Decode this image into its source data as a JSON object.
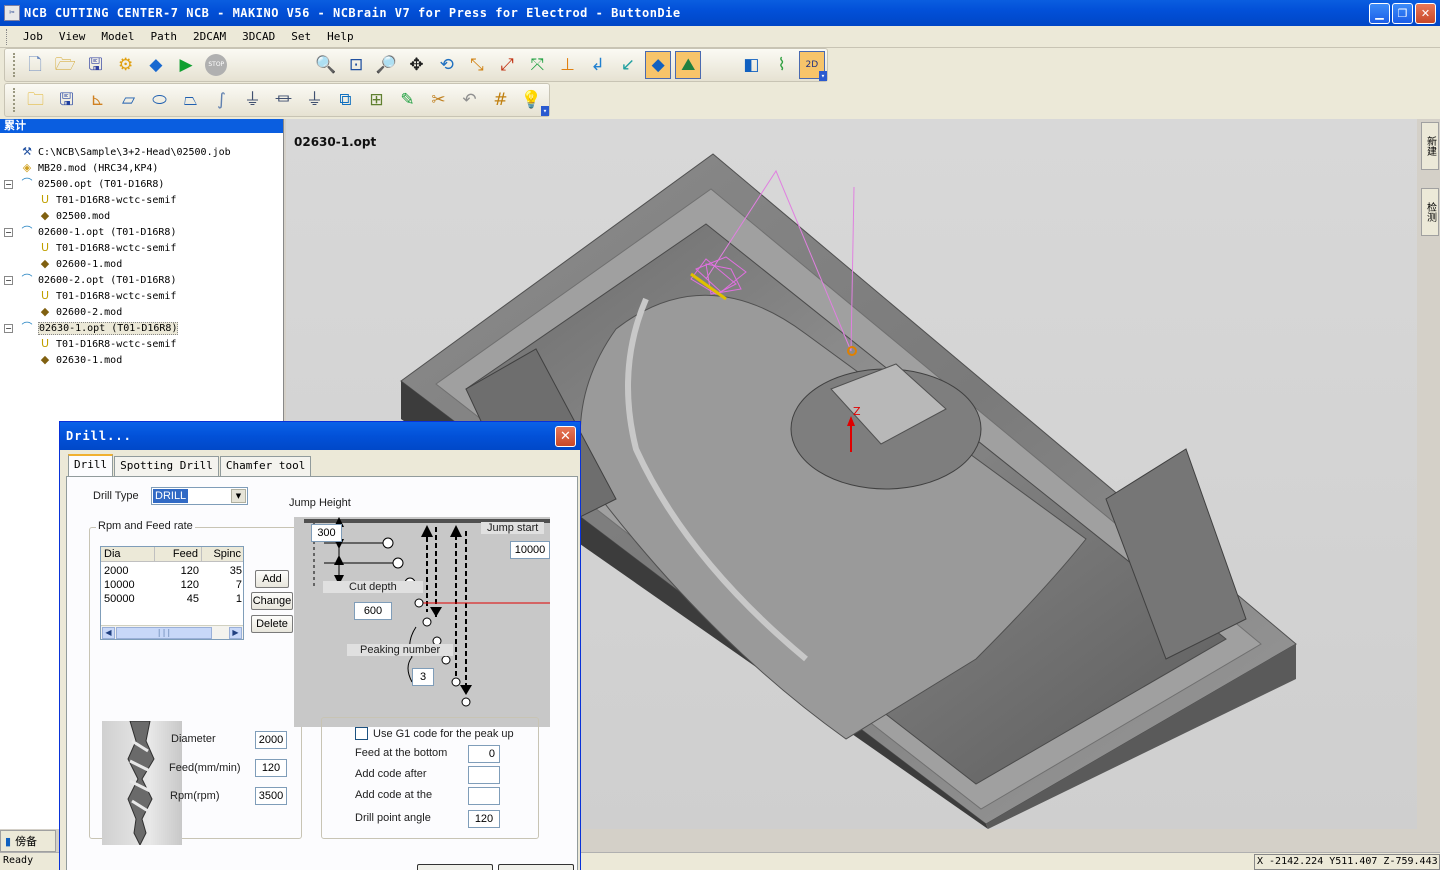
{
  "window": {
    "title": "NCB CUTTING CENTER-7 NCB - MAKINO V56 - NCBrain V7 for Press for Electrod - ButtonDie",
    "app_icon": "ncb-app-icon"
  },
  "menu": [
    "Job",
    "View",
    "Model",
    "Path",
    "2DCAM",
    "3DCAD",
    "Set",
    "Help"
  ],
  "toolbar1": {
    "left_icons": [
      "new-file-icon",
      "new-job-icon",
      "save-icon",
      "tools-icon",
      "cube-icon",
      "run-icon",
      "stop-icon"
    ],
    "stop_label": "STOP",
    "view_icons": [
      "zoom-window-icon",
      "zoom-fit-icon",
      "zoom-icon",
      "pan-icon",
      "rotate-icon",
      "view-x-icon",
      "view-z-icon",
      "view-iso-icon",
      "view-front-icon",
      "view-right-icon",
      "view-top-icon",
      "view-shade-icon",
      "view-wire-icon"
    ],
    "right_icons": [
      "simulation-icon",
      "toolpath-icon",
      "2d-view-icon"
    ],
    "toggle_2d_label": "2D"
  },
  "toolbar2": {
    "icons": [
      "open-folder-icon",
      "save-disk-icon",
      "axis-icon",
      "eraser-icon",
      "ellipse-icon",
      "shape-icon",
      "curve-icon",
      "tool-1-icon",
      "tool-2-icon",
      "tool-3-icon",
      "transform-icon",
      "chip-icon",
      "paint-icon",
      "cut-icon",
      "undo-icon",
      "grid-icon",
      "light-icon"
    ]
  },
  "tree": {
    "header": "累计",
    "items": [
      {
        "label": "C:\\NCB\\Sample\\3+2-Head\\02500.job",
        "icon": "job-icon"
      },
      {
        "label": "MB20.mod (HRC34,KP4)",
        "icon": "model-icon"
      },
      {
        "label": "02500.opt  (T01-D16R8)",
        "icon": "operation-icon"
      },
      {
        "label": "T01-D16R8-wctc-semif",
        "icon": "tool-icon"
      },
      {
        "label": "02500.mod",
        "icon": "part-icon"
      },
      {
        "label": "02600-1.opt  (T01-D16R8)",
        "icon": "operation-icon"
      },
      {
        "label": "T01-D16R8-wctc-semif",
        "icon": "tool-icon"
      },
      {
        "label": "02600-1.mod",
        "icon": "part-icon"
      },
      {
        "label": "02600-2.opt  (T01-D16R8)",
        "icon": "operation-icon"
      },
      {
        "label": "T01-D16R8-wctc-semif",
        "icon": "tool-icon"
      },
      {
        "label": "02600-2.mod",
        "icon": "part-icon"
      },
      {
        "label": "02630-1.opt  (T01-D16R8)",
        "icon": "operation-icon"
      },
      {
        "label": "T01-D16R8-wctc-semif",
        "icon": "tool-icon"
      },
      {
        "label": "02630-1.mod",
        "icon": "part-icon"
      }
    ]
  },
  "viewport": {
    "title": "02630-1.opt",
    "axis_label": "Z"
  },
  "side_tabs": [
    "新建",
    "检测"
  ],
  "bottom_tab": "傍备",
  "status": {
    "ready": "Ready",
    "coords": "X -2142.224 Y511.407 Z-759.443"
  },
  "dialog": {
    "title": "Drill...",
    "tabs": [
      "Drill",
      "Spotting Drill",
      "Chamfer tool"
    ],
    "drill_type_label": "Drill Type",
    "drill_type_value": "DRILL",
    "rpm_group_label": "Rpm and Feed rate",
    "table": {
      "columns": [
        "Dia",
        "Feed",
        "Spinc"
      ],
      "rows": [
        [
          "2000",
          "120",
          "35"
        ],
        [
          "10000",
          "120",
          "7"
        ],
        [
          "50000",
          "45",
          "1"
        ]
      ]
    },
    "buttons": {
      "add": "Add",
      "change": "Change",
      "delete": "Delete"
    },
    "diameter_label": "Diameter",
    "diameter_value": "2000",
    "feed_label": "Feed(mm/min)",
    "feed_value": "120",
    "rpm_label": "Rpm(rpm)",
    "rpm_value": "3500",
    "jump_height_label": "Jump Height",
    "jump_height_value": "300",
    "jump_start_label": "Jump start",
    "jump_start_value": "10000",
    "cut_depth_label": "Cut depth",
    "cut_depth_value": "600",
    "peaking_number_label": "Peaking number",
    "peaking_number_value": "3",
    "use_g1_label": "Use G1 code for the peak up",
    "use_g1_checked": false,
    "feed_bottom_label": "Feed at the bottom",
    "feed_bottom_value": "0",
    "add_code_after_label": "Add code after",
    "add_code_after_value": "",
    "add_code_at_label": "Add code at the",
    "add_code_at_value": "",
    "drill_point_angle_label": "Drill point angle",
    "drill_point_angle_value": "120"
  }
}
